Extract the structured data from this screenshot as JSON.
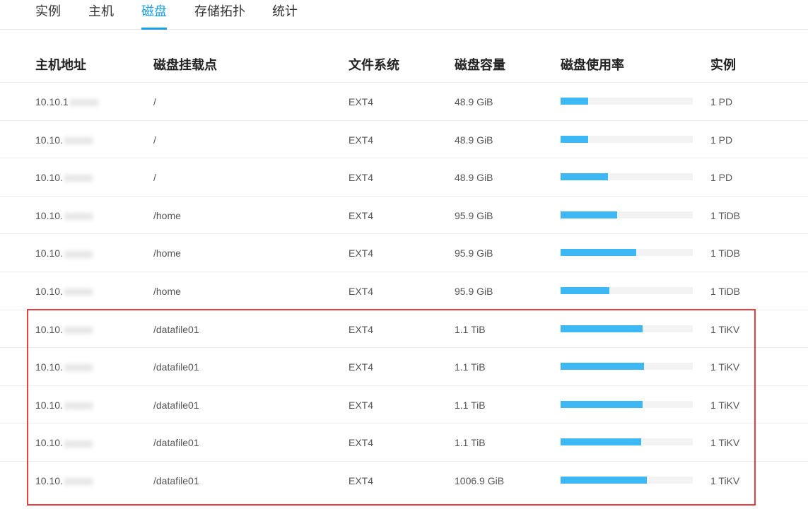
{
  "tabs": [
    "实例",
    "主机",
    "磁盘",
    "存储拓扑",
    "统计"
  ],
  "active_tab": 2,
  "columns": [
    "主机地址",
    "磁盘挂载点",
    "文件系统",
    "磁盘容量",
    "磁盘使用率",
    "实例"
  ],
  "rows": [
    {
      "host": "10.10.1",
      "mount": "/",
      "fs": "EXT4",
      "size": "48.9 GiB",
      "usage": 0.21,
      "instance": "1 PD"
    },
    {
      "host": "10.10.",
      "mount": "/",
      "fs": "EXT4",
      "size": "48.9 GiB",
      "usage": 0.21,
      "instance": "1 PD"
    },
    {
      "host": "10.10.",
      "mount": "/",
      "fs": "EXT4",
      "size": "48.9 GiB",
      "usage": 0.36,
      "instance": "1 PD"
    },
    {
      "host": "10.10.",
      "mount": "/home",
      "fs": "EXT4",
      "size": "95.9 GiB",
      "usage": 0.43,
      "instance": "1 TiDB"
    },
    {
      "host": "10.10.",
      "mount": "/home",
      "fs": "EXT4",
      "size": "95.9 GiB",
      "usage": 0.57,
      "instance": "1 TiDB"
    },
    {
      "host": "10.10.",
      "mount": "/home",
      "fs": "EXT4",
      "size": "95.9 GiB",
      "usage": 0.37,
      "instance": "1 TiDB"
    },
    {
      "host": "10.10.",
      "mount": "/datafile01",
      "fs": "EXT4",
      "size": "1.1 TiB",
      "usage": 0.62,
      "instance": "1 TiKV"
    },
    {
      "host": "10.10.",
      "mount": "/datafile01",
      "fs": "EXT4",
      "size": "1.1 TiB",
      "usage": 0.63,
      "instance": "1 TiKV"
    },
    {
      "host": "10.10.",
      "mount": "/datafile01",
      "fs": "EXT4",
      "size": "1.1 TiB",
      "usage": 0.62,
      "instance": "1 TiKV"
    },
    {
      "host": "10.10.",
      "mount": "/datafile01",
      "fs": "EXT4",
      "size": "1.1 TiB",
      "usage": 0.61,
      "instance": "1 TiKV"
    },
    {
      "host": "10.10.",
      "mount": "/datafile01",
      "fs": "EXT4",
      "size": "1006.9 GiB",
      "usage": 0.65,
      "instance": "1 TiKV"
    }
  ],
  "colors": {
    "accent": "#1b9ee8",
    "bar": "#3db8f5",
    "highlight": "#e84040"
  }
}
